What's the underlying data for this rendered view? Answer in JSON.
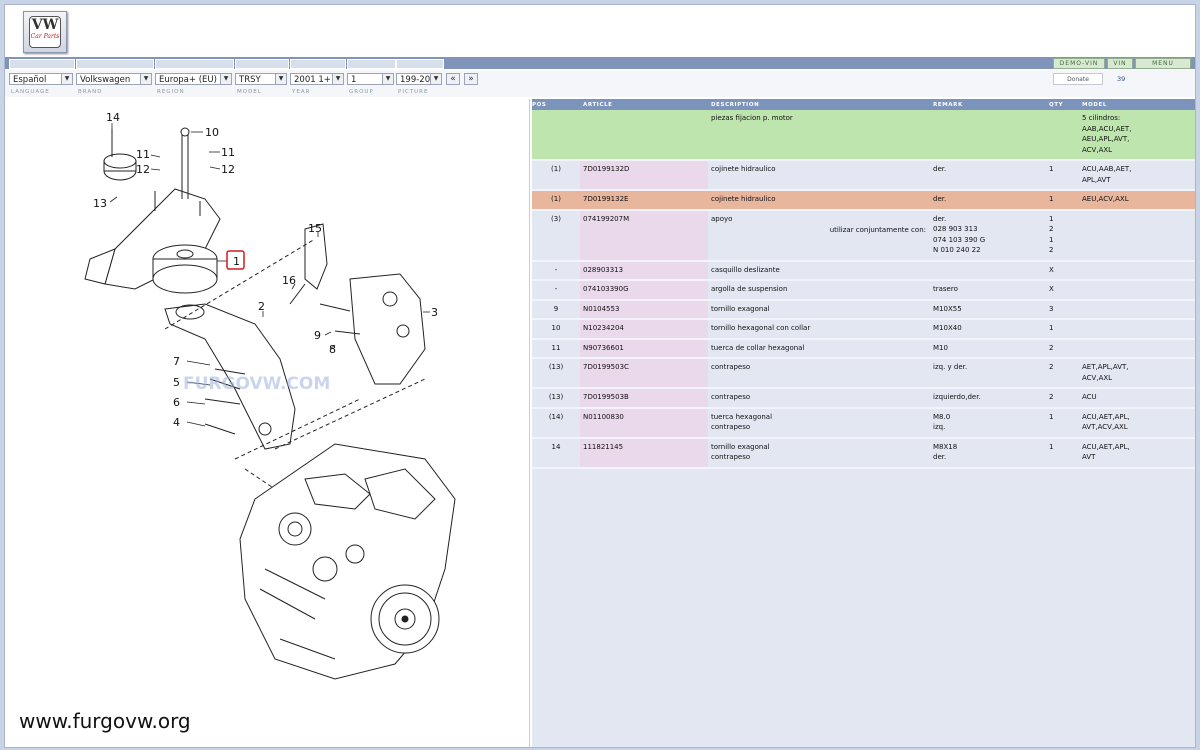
{
  "app": {
    "logo_text": "VW",
    "logo_subtext": "Car Parts"
  },
  "toolbar": {
    "demo_vin": "DEMO-VIN",
    "vin": "VIN",
    "menu": "MENU",
    "donate": "Donate",
    "page_number": "39"
  },
  "selectors": {
    "language": "Español",
    "brand": "Volkswagen",
    "region": "Europa+ (EU)",
    "model": "TRSY",
    "year": "2001 1+",
    "group": "1",
    "picture": "199-20",
    "prev": "«",
    "next": "»"
  },
  "labels": {
    "language": "LANGUAGE",
    "brand": "BRAND",
    "region": "REGION",
    "model": "MODEL",
    "year": "YEAR",
    "group": "GROUP",
    "picture": "PICTURE"
  },
  "diagram": {
    "callouts": [
      "14",
      "10",
      "11",
      "11",
      "12",
      "12",
      "13",
      "1",
      "15",
      "16",
      "2",
      "3",
      "9",
      "8",
      "7",
      "5",
      "6",
      "4"
    ],
    "watermark_text": "FURGOVW.COM",
    "site_url": "www.furgovw.org"
  },
  "table": {
    "headers": [
      "POS",
      "ARTICLE",
      "DESCRIPTION",
      "REMARK",
      "QTY",
      "MODEL"
    ],
    "rows": [
      {
        "pos": "",
        "article": "",
        "description": [
          "piezas fijacion p. motor"
        ],
        "remark": [],
        "qty": [],
        "model": [
          "5 cilindros:",
          "AAB,ACU,AET,",
          "AEU,APL,AVT,",
          "ACV,AXL"
        ],
        "style": "green"
      },
      {
        "pos": "(1)",
        "article": "7D0199132D",
        "description": [
          "cojinete hidraulico"
        ],
        "remark": [
          "der."
        ],
        "qty": [
          "1"
        ],
        "model": [
          "ACU,AAB,AET,",
          "APL,AVT"
        ],
        "style": ""
      },
      {
        "pos": "(1)",
        "article": "7D0199132E",
        "description": [
          "cojinete hidraulico"
        ],
        "remark": [
          "der."
        ],
        "qty": [
          "1"
        ],
        "model": [
          "AEU,ACV,AXL"
        ],
        "style": "highlight"
      },
      {
        "pos": "(3)",
        "article": "074199207M",
        "description": [
          "apoyo"
        ],
        "remark_prefix": "utilizar conjuntamente con:",
        "remark": [
          "der.",
          "028 903 313",
          "074 103 390 G",
          "N  010 240 22"
        ],
        "qty": [
          "1",
          "2",
          "1",
          "2"
        ],
        "model": [],
        "style": ""
      },
      {
        "pos": "-",
        "article": "028903313",
        "description": [
          "casquillo deslizante"
        ],
        "remark": [],
        "qty": [
          "X"
        ],
        "model": [],
        "style": ""
      },
      {
        "pos": "-",
        "article": "074103390G",
        "description": [
          "argolla de suspension"
        ],
        "remark": [
          "trasero"
        ],
        "qty": [
          "X"
        ],
        "model": [],
        "style": ""
      },
      {
        "pos": "9",
        "article": "N0104553",
        "description": [
          "tornillo exagonal"
        ],
        "remark": [
          "M10X55"
        ],
        "qty": [
          "3"
        ],
        "model": [],
        "style": ""
      },
      {
        "pos": "10",
        "article": "N10234204",
        "description": [
          "tornillo hexagonal con collar"
        ],
        "remark": [
          "M10X40"
        ],
        "qty": [
          "1"
        ],
        "model": [],
        "style": ""
      },
      {
        "pos": "11",
        "article": "N90736601",
        "description": [
          "tuerca de collar hexagonal"
        ],
        "remark": [
          "M10"
        ],
        "qty": [
          "2"
        ],
        "model": [],
        "style": ""
      },
      {
        "pos": "(13)",
        "article": "7D0199503C",
        "description": [
          "contrapeso"
        ],
        "remark": [
          "izq. y der."
        ],
        "qty": [
          "2"
        ],
        "model": [
          "AET,APL,AVT,",
          "ACV,AXL"
        ],
        "style": ""
      },
      {
        "pos": "(13)",
        "article": "7D0199503B",
        "description": [
          "contrapeso"
        ],
        "remark": [
          "izquierdo,der."
        ],
        "qty": [
          "2"
        ],
        "model": [
          "ACU"
        ],
        "style": ""
      },
      {
        "pos": "(14)",
        "article": "N01100830",
        "description": [
          "tuerca hexagonal",
          "contrapeso"
        ],
        "remark": [
          "M8.0",
          "izq."
        ],
        "qty": [
          "1"
        ],
        "model": [
          "ACU,AET,APL,",
          "AVT,ACV,AXL"
        ],
        "style": ""
      },
      {
        "pos": "14",
        "article": "111821145",
        "description": [
          "tornillo exagonal",
          "contrapeso"
        ],
        "remark": [
          "M8X18",
          "der."
        ],
        "qty": [
          "1"
        ],
        "model": [
          "ACU,AET,APL,",
          "AVT"
        ],
        "style": ""
      }
    ]
  }
}
